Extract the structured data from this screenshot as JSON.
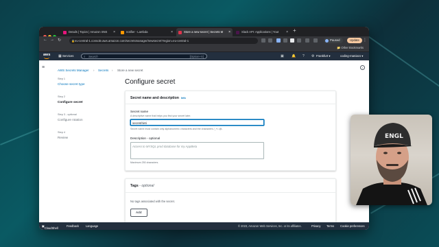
{
  "browser": {
    "tabs": [
      {
        "label": "Details | Topics | Amazon SNS",
        "color": "#e7157b"
      },
      {
        "label": "notifier - Lambda",
        "color": "#ff9900"
      },
      {
        "label": "Store a new secret | Secrets M",
        "color": "#dd344c"
      },
      {
        "label": "Slack API: Applications | Yout",
        "color": "#4a154b"
      }
    ],
    "url": "eu-central-1.console.aws.amazon.com/secretsmanager/newsecret?region=eu-central-1",
    "profile_status": "Paused",
    "update_label": "Update",
    "other_bookmarks": "Other Bookmarks"
  },
  "aws_nav": {
    "logo": "aws",
    "services": "Services",
    "search_placeholder": "Search",
    "search_shortcut": "[Option+S]",
    "region": "Frankfurt",
    "account": "coding-maniacs"
  },
  "breadcrumb": [
    "AWS Secrets Manager",
    "Secrets",
    "Store a new secret"
  ],
  "steps": [
    {
      "label": "Step 1",
      "text": "Choose secret type"
    },
    {
      "label": "Step 2",
      "text": "Configure secret"
    },
    {
      "label": "Step 3 - optional",
      "text": "Configure rotation"
    },
    {
      "label": "Step 4",
      "text": "Review"
    }
  ],
  "page_title": "Configure secret",
  "name_panel": {
    "title": "Secret name and description",
    "info": "Info",
    "name_label": "Secret name",
    "name_hint": "A descriptive name that helps you find your secret later.",
    "name_value": "secret/rieti",
    "name_constraint": "Secret name must contain only alphanumeric characters and the characters /_+=.@-",
    "desc_label": "Description - optional",
    "desc_placeholder": "Access to MYSQL prod database for my AppBeta",
    "desc_constraint": "Maximum 250 characters."
  },
  "tags_panel": {
    "title": "Tags",
    "optional": " - optional",
    "empty": "No tags associated with the secret.",
    "add_button": "Add"
  },
  "footer": {
    "cloudshell": "CloudShell",
    "feedback": "Feedback",
    "language": "Language",
    "copyright": "© 2023, Amazon Web Services, Inc. or its affiliates.",
    "privacy": "Privacy",
    "terms": "Terms",
    "cookies": "Cookie preferences"
  },
  "webcam": {
    "cap_text": "ENGL"
  }
}
